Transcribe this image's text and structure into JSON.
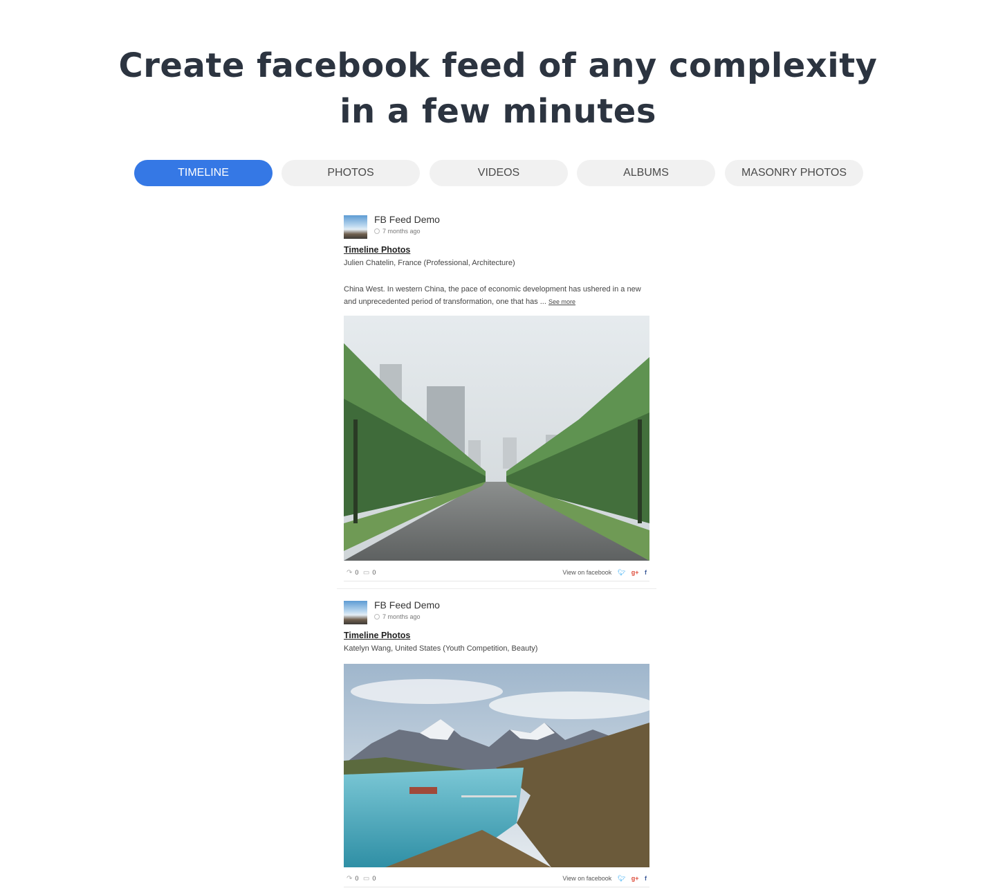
{
  "headline": {
    "line1": "Create facebook feed of any complexity",
    "line2": "in a few minutes"
  },
  "tabs": [
    {
      "label": "TIMELINE",
      "active": true
    },
    {
      "label": "PHOTOS",
      "active": false
    },
    {
      "label": "VIDEOS",
      "active": false
    },
    {
      "label": "ALBUMS",
      "active": false
    },
    {
      "label": "MASONRY PHOTOS",
      "active": false
    }
  ],
  "colors": {
    "accent": "#3578e5",
    "tab_inactive": "#f1f1f1",
    "headline": "#2c3440"
  },
  "posts": [
    {
      "author": "FB Feed Demo",
      "time": "7 months ago",
      "title": "Timeline Photos",
      "subtitle": "Julien Chatelin, France (Professional, Architecture)",
      "body": "China West. In western China, the pace of economic development has ushered in a new and unprecedented period of transformation, one that has ...",
      "see_more": "See more",
      "shares": "0",
      "comments": "0",
      "view_link": "View on facebook"
    },
    {
      "author": "FB Feed Demo",
      "time": "7 months ago",
      "title": "Timeline Photos",
      "subtitle": "Katelyn Wang, United States (Youth Competition, Beauty)",
      "shares": "0",
      "comments": "0",
      "view_link": "View on facebook"
    }
  ]
}
